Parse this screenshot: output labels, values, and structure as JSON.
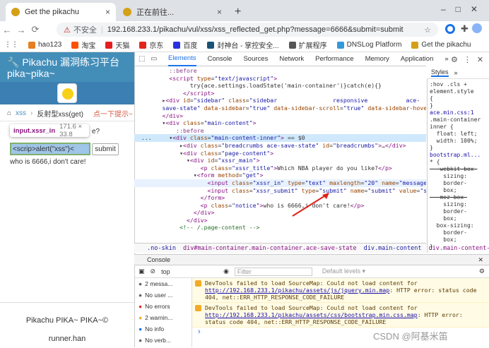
{
  "browser": {
    "tabs": [
      {
        "title": "Get the pikachu",
        "close": "×"
      },
      {
        "title": "正在前往...",
        "close": "×"
      }
    ],
    "new_tab": "+",
    "security": "不安全",
    "url": "192.168.233.1/pikachu/vul/xss/xss_reflected_get.php?message=6666&submit=submit",
    "bookmarks": [
      {
        "label": "hao123",
        "color": "#e67e22"
      },
      {
        "label": "淘宝",
        "color": "#ff5000"
      },
      {
        "label": "天猫",
        "color": "#e31f1f"
      },
      {
        "label": "京东",
        "color": "#e1251b"
      },
      {
        "label": "百度",
        "color": "#2932e1"
      },
      {
        "label": "封神台 - 掌控安全...",
        "color": "#1a5276"
      },
      {
        "label": "扩展程序",
        "color": "#555"
      },
      {
        "label": "DNSLog Platform",
        "color": "#3498db"
      },
      {
        "label": "Get the pikachu",
        "color": "#d4a017"
      }
    ]
  },
  "page": {
    "title": "Pikachu 漏洞练习平台 pika~pika~",
    "crumb_root": "xss",
    "crumb_leaf": "反射型xss(get)",
    "hint": "点一下提示~",
    "tooltip_tag": "input.xssr_in",
    "tooltip_size": "171.6 × 33.8",
    "partial_q": "e?",
    "input_value": "<scrip>alert(\"xss\")<",
    "submit": "submit",
    "notice": "who is 6666,i don't care!",
    "footer1": "Pikachu PIKA~ PIKA~©",
    "footer2": "runner.han"
  },
  "devtools": {
    "tabs": [
      "Elements",
      "Console",
      "Sources",
      "Network",
      "Performance",
      "Memory",
      "Application",
      "»"
    ],
    "crumbs": [
      ".no-skin",
      "div#main-container.main-container.ace-save-state",
      "div.main-content",
      "div.main-content-inner"
    ],
    "styles_tabs": [
      "Styles",
      "»"
    ],
    "styles_filter": ":hov  .cls  +",
    "styles_lines": [
      "element.style",
      "{",
      "}",
      "ace.min.css:1",
      ".main-container",
      "inner {",
      "  float: left;",
      "  width: 100%;",
      "}",
      "bootstrap.ml...",
      "* {",
      "  -webkit-box-",
      "    sizing:",
      "    border-",
      "    box;",
      "  -moz-box-",
      "    sizing:",
      "    border-",
      "    box;",
      "  box-sizing:",
      "    border-",
      "    box;",
      "}"
    ],
    "console_label": "Console",
    "console_context": "top",
    "filter_placeholder": "Filter",
    "levels": "Default levels ▾",
    "side": [
      {
        "label": "2 messa...",
        "color": "#5f6368"
      },
      {
        "label": "No user ...",
        "color": "#5f6368"
      },
      {
        "label": "No errors",
        "color": "#d93025"
      },
      {
        "label": "2 warnin...",
        "color": "#f2ab26"
      },
      {
        "label": "No info",
        "color": "#1a73e8"
      },
      {
        "label": "No verb...",
        "color": "#5f6368"
      }
    ],
    "messages": [
      {
        "pre": "DevTools failed to load SourceMap: Could not load content for ",
        "link": "http://192.168.233.1/pikachu/assets/js/jquery.min.map",
        "post": ": HTTP error: status code 404, net::ERR_HTTP_RESPONSE_CODE_FAILURE"
      },
      {
        "pre": "DevTools failed to load SourceMap: Could not load content for ",
        "link": "http://192.168.233.1/pikachu/assets/css/bootstrap.min.css.map",
        "post": ": HTTP error: status code 404, net::ERR_HTTP_RESPONSE_CODE_FAILURE"
      }
    ],
    "prompt": "›"
  },
  "watermark": "CSDN @阿基米笛"
}
